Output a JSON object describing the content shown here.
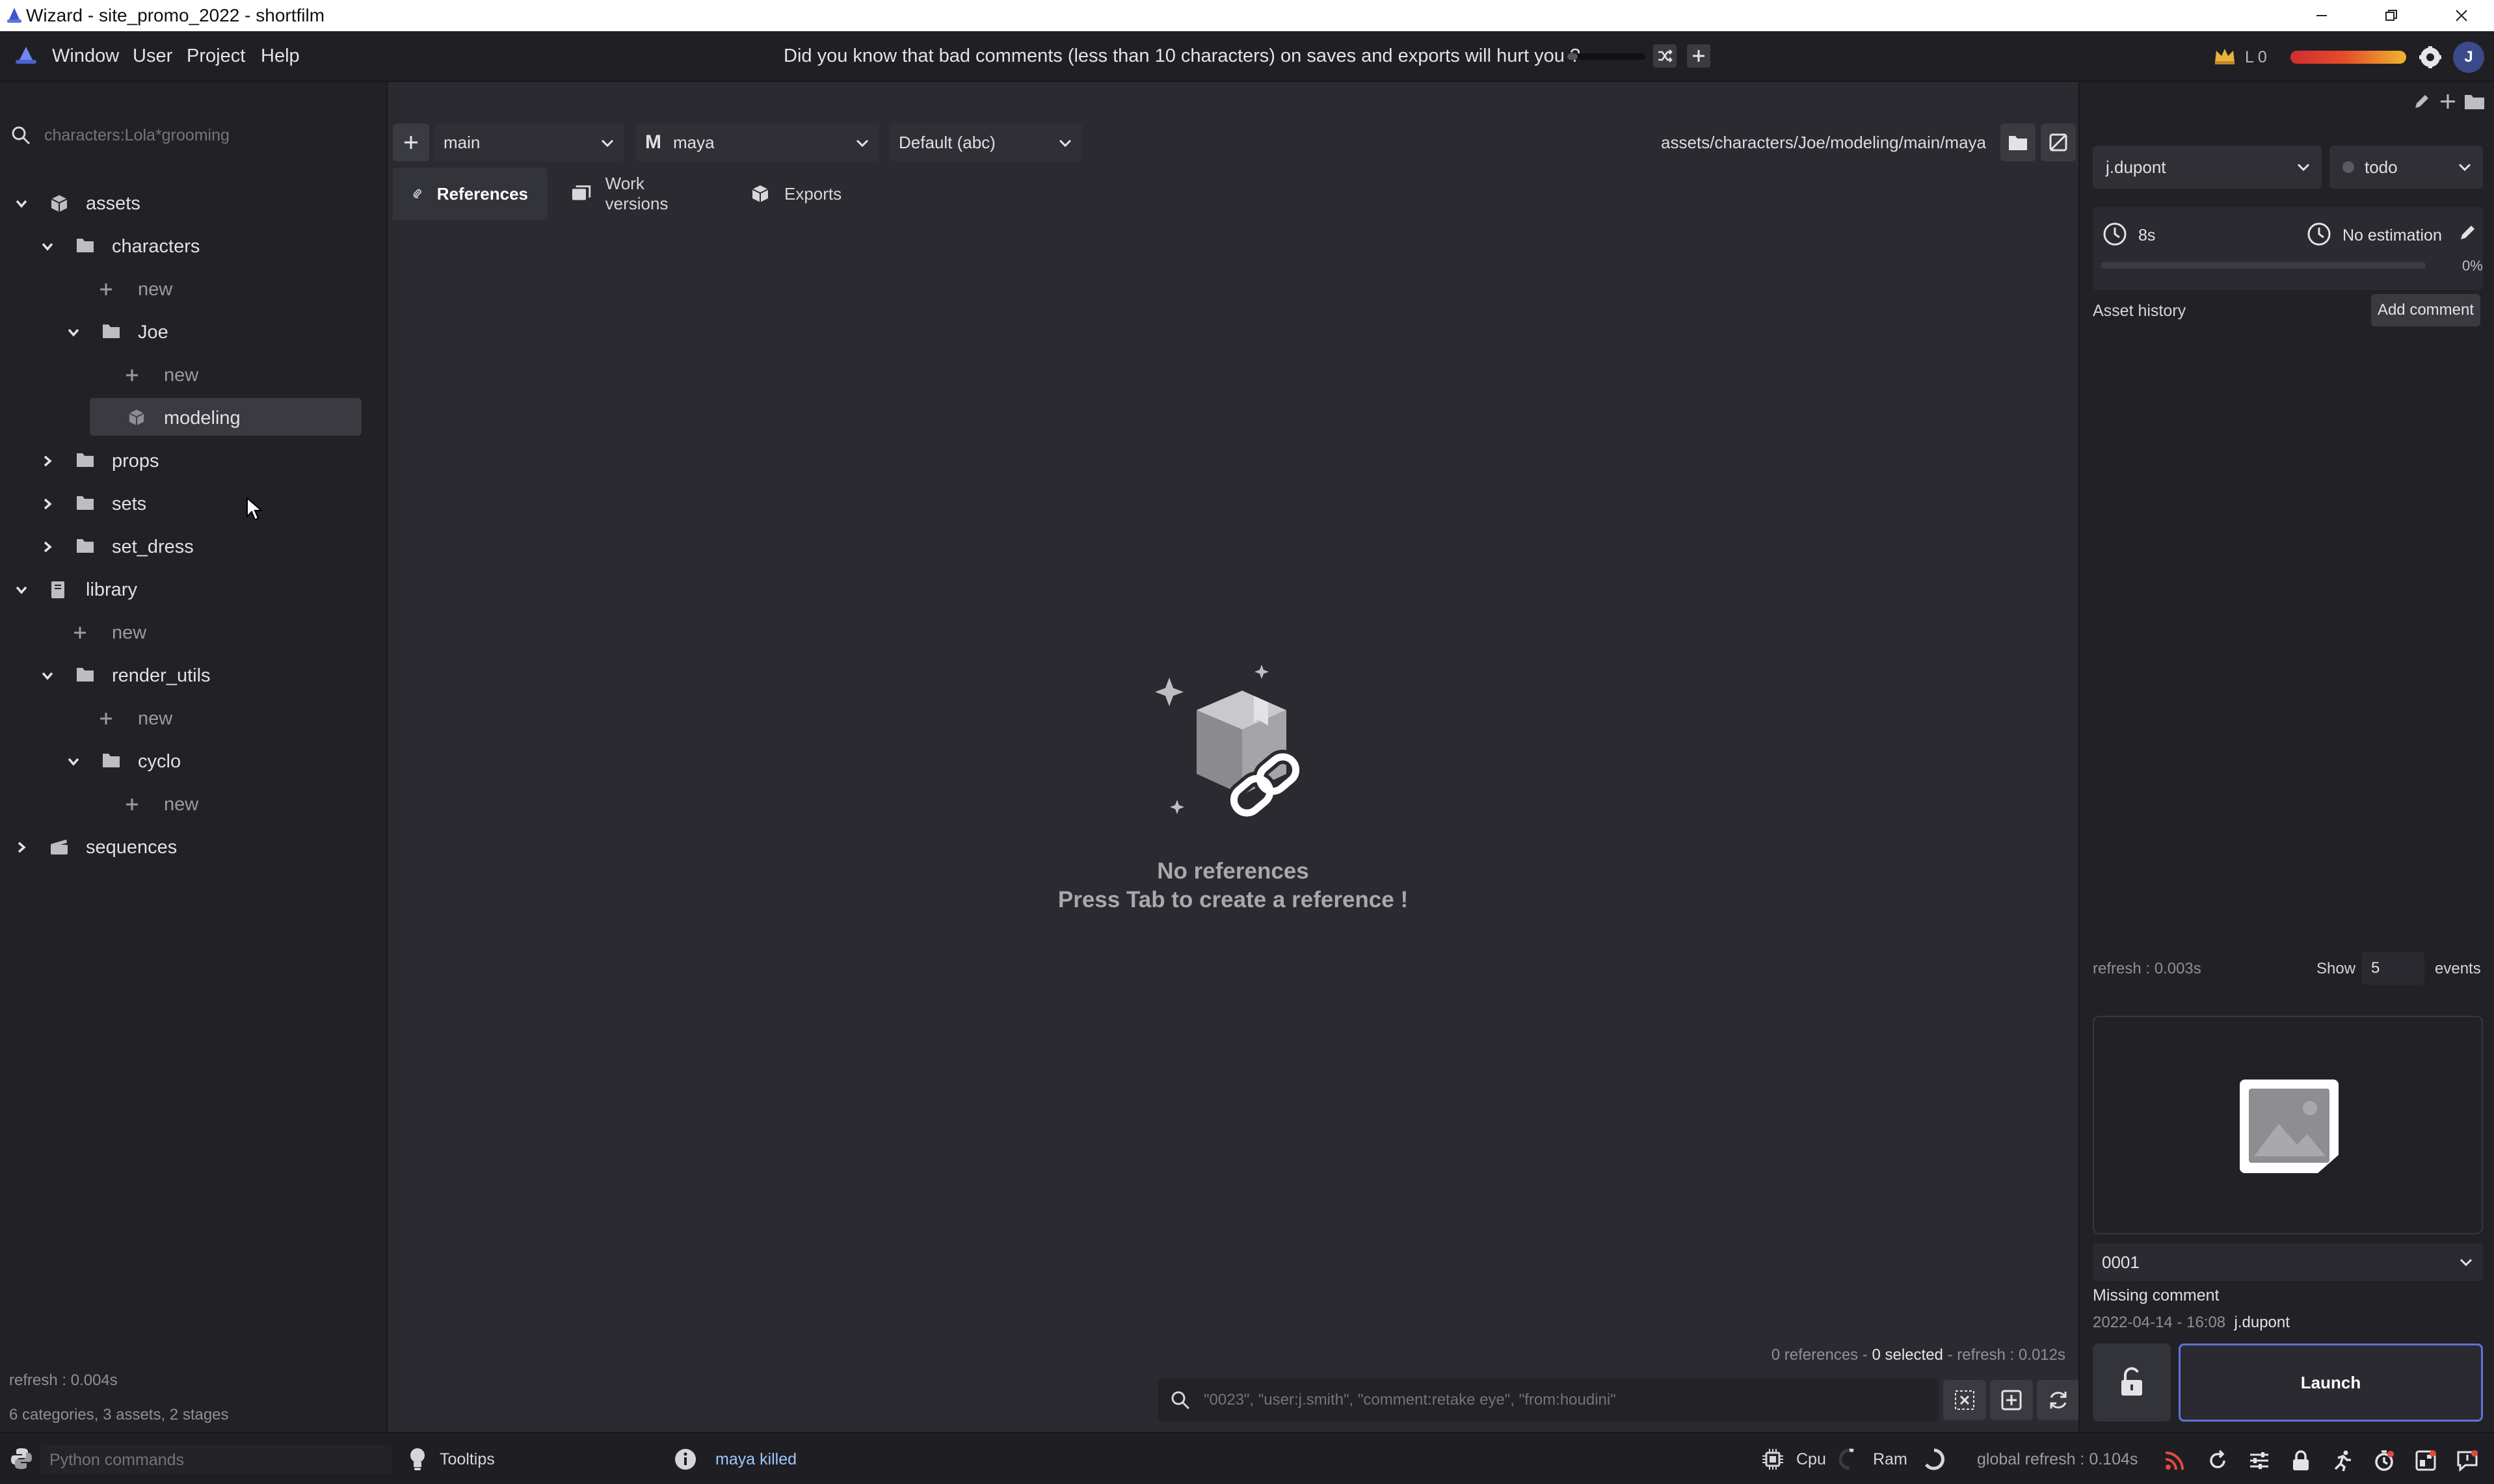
{
  "window": {
    "title": "Wizard - site_promo_2022 - shortfilm"
  },
  "menu": {
    "items": [
      "Window",
      "User",
      "Project",
      "Help"
    ]
  },
  "tip": {
    "text": "Did you know that bad comments (less than 10 characters) on saves and exports will hurt you ?"
  },
  "header_right": {
    "level": "L 0",
    "avatar_letter": "J"
  },
  "left": {
    "search_placeholder": "characters:Lola*grooming",
    "tree": [
      {
        "label": "assets",
        "depth": 0,
        "expanded": true,
        "kind": "box"
      },
      {
        "label": "characters",
        "depth": 1,
        "expanded": true,
        "kind": "folder"
      },
      {
        "label": "new",
        "depth": 2,
        "kind": "new"
      },
      {
        "label": "Joe",
        "depth": 2,
        "expanded": true,
        "kind": "folder"
      },
      {
        "label": "new",
        "depth": 3,
        "kind": "new"
      },
      {
        "label": "modeling",
        "depth": 3,
        "kind": "stage",
        "selected": true
      },
      {
        "label": "props",
        "depth": 1,
        "expanded": false,
        "kind": "folder"
      },
      {
        "label": "sets",
        "depth": 1,
        "expanded": false,
        "kind": "folder"
      },
      {
        "label": "set_dress",
        "depth": 1,
        "expanded": false,
        "kind": "folder"
      },
      {
        "label": "library",
        "depth": 0,
        "expanded": true,
        "kind": "book"
      },
      {
        "label": "new",
        "depth": 1,
        "kind": "new"
      },
      {
        "label": "render_utils",
        "depth": 1,
        "expanded": true,
        "kind": "folder"
      },
      {
        "label": "new",
        "depth": 2,
        "kind": "new"
      },
      {
        "label": "cyclo",
        "depth": 2,
        "expanded": true,
        "kind": "folder"
      },
      {
        "label": "new",
        "depth": 3,
        "kind": "new"
      },
      {
        "label": "sequences",
        "depth": 0,
        "expanded": false,
        "kind": "clap"
      }
    ],
    "status_refresh": "refresh : 0.004s",
    "status_summary": "6 categories, 3 assets, 2 stages"
  },
  "center": {
    "variant": "main",
    "software": "maya",
    "software_letter": "M",
    "export_format": "Default (abc)",
    "path": "assets/characters/Joe/modeling/main/maya",
    "tabs": [
      "References",
      "Work versions",
      "Exports"
    ],
    "empty_title": "No references",
    "empty_sub": "Press Tab to create a reference !",
    "status_refs": "0 references - ",
    "status_selected": "0 selected",
    "status_refresh": " - refresh : 0.012s",
    "filter_placeholder": "\"0023\", \"user:j.smith\", \"comment:retake eye\", \"from:houdini\""
  },
  "right": {
    "user": "j.dupont",
    "state": "todo",
    "time_spent": "8s",
    "estimation": "No estimation",
    "progress_percent": "0%",
    "progress_value": 0,
    "history_label": "Asset history",
    "add_comment": "Add comment",
    "refresh": "refresh : 0.003s",
    "show_label": "Show",
    "show_value": "5",
    "events_label": "events",
    "version": "0001",
    "missing_comment": "Missing comment",
    "version_date": "2022-04-14 - 16:08",
    "version_user": "j.dupont",
    "launch": "Launch"
  },
  "statusbar": {
    "python_placeholder": "Python commands",
    "tooltips": "Tooltips",
    "message": "maya killed",
    "cpu": "Cpu",
    "ram": "Ram",
    "global_refresh": "global refresh : 0.104s"
  },
  "colors": {
    "background": "#2b2b31",
    "accent_blue": "#5c74d8",
    "message_blue": "#9ec6ff",
    "gold": "#e8b33c"
  }
}
